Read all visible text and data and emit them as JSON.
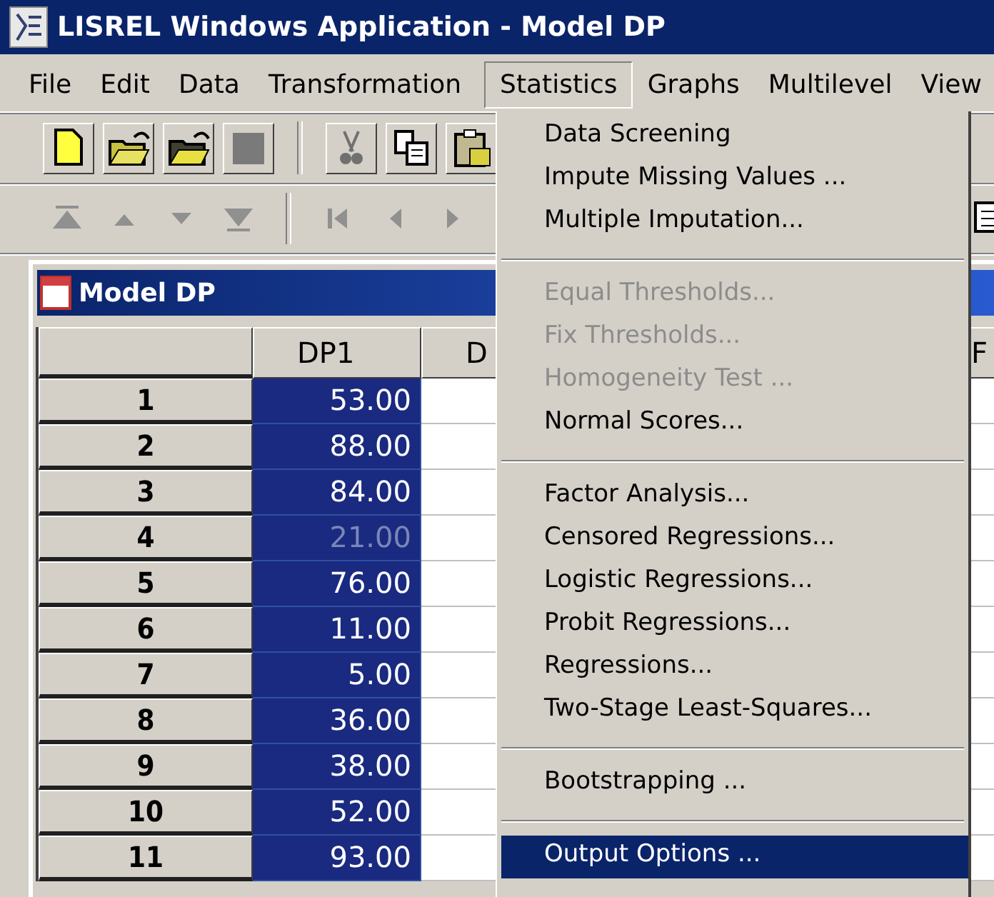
{
  "window": {
    "title": "LISREL Windows Application - Model DP"
  },
  "menu_bar": [
    {
      "label": "File",
      "selected": false
    },
    {
      "label": "Edit",
      "selected": false
    },
    {
      "label": "Data",
      "selected": false
    },
    {
      "label": "Transformation",
      "selected": false
    },
    {
      "label": "Statistics",
      "selected": true
    },
    {
      "label": "Graphs",
      "selected": false
    },
    {
      "label": "Multilevel",
      "selected": false
    },
    {
      "label": "View",
      "selected": false
    }
  ],
  "dropdown": {
    "items": [
      {
        "kind": "item",
        "label": "Data Screening",
        "disabled": false,
        "selected": false
      },
      {
        "kind": "item",
        "label": "Impute Missing Values ...",
        "disabled": false,
        "selected": false
      },
      {
        "kind": "item",
        "label": "Multiple Imputation...",
        "disabled": false,
        "selected": false
      },
      {
        "kind": "separator"
      },
      {
        "kind": "item",
        "label": "Equal Thresholds...",
        "disabled": true,
        "selected": false
      },
      {
        "kind": "item",
        "label": "Fix Thresholds...",
        "disabled": true,
        "selected": false
      },
      {
        "kind": "item",
        "label": "Homogeneity Test ...",
        "disabled": true,
        "selected": false
      },
      {
        "kind": "item",
        "label": "Normal Scores...",
        "disabled": false,
        "selected": false
      },
      {
        "kind": "separator"
      },
      {
        "kind": "item",
        "label": "Factor Analysis...",
        "disabled": false,
        "selected": false
      },
      {
        "kind": "item",
        "label": "Censored Regressions...",
        "disabled": false,
        "selected": false
      },
      {
        "kind": "item",
        "label": "Logistic Regressions...",
        "disabled": false,
        "selected": false
      },
      {
        "kind": "item",
        "label": "Probit Regressions...",
        "disabled": false,
        "selected": false
      },
      {
        "kind": "item",
        "label": "Regressions...",
        "disabled": false,
        "selected": false
      },
      {
        "kind": "item",
        "label": "Two-Stage Least-Squares...",
        "disabled": false,
        "selected": false
      },
      {
        "kind": "separator"
      },
      {
        "kind": "item",
        "label": "Bootstrapping ...",
        "disabled": false,
        "selected": false
      },
      {
        "kind": "separator"
      },
      {
        "kind": "item",
        "label": "Output Options ...",
        "disabled": false,
        "selected": true
      }
    ]
  },
  "child_window": {
    "title": "Model DP"
  },
  "grid": {
    "columns": [
      {
        "label": "DP1"
      },
      {
        "label": "D"
      },
      {},
      {},
      {
        "label": "F"
      }
    ],
    "rows": [
      {
        "header": "1",
        "cells": [
          {
            "value": "53.00",
            "selected": true,
            "current": false
          }
        ]
      },
      {
        "header": "2",
        "cells": [
          {
            "value": "88.00",
            "selected": true,
            "current": false
          }
        ]
      },
      {
        "header": "3",
        "cells": [
          {
            "value": "84.00",
            "selected": true,
            "current": false
          }
        ]
      },
      {
        "header": "4",
        "cells": [
          {
            "value": "21.00",
            "selected": true,
            "current": true
          }
        ]
      },
      {
        "header": "5",
        "cells": [
          {
            "value": "76.00",
            "selected": true,
            "current": false
          }
        ]
      },
      {
        "header": "6",
        "cells": [
          {
            "value": "11.00",
            "selected": true,
            "current": false
          }
        ]
      },
      {
        "header": "7",
        "cells": [
          {
            "value": "5.00",
            "selected": true,
            "current": false
          }
        ]
      },
      {
        "header": "8",
        "cells": [
          {
            "value": "36.00",
            "selected": true,
            "current": false
          }
        ]
      },
      {
        "header": "9",
        "cells": [
          {
            "value": "38.00",
            "selected": true,
            "current": false
          }
        ]
      },
      {
        "header": "10",
        "cells": [
          {
            "value": "52.00",
            "selected": true,
            "current": false
          }
        ]
      },
      {
        "header": "11",
        "cells": [
          {
            "value": "93.00",
            "selected": true,
            "current": false
          }
        ]
      }
    ]
  }
}
